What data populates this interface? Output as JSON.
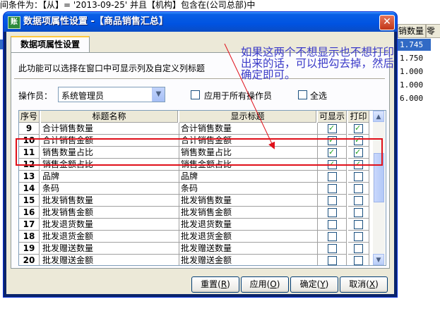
{
  "background": {
    "topline": "间条件为：【从】= '2013-09-25' 并且【机构】包含在(公司总部)中",
    "grid_headers": [
      "销数量",
      "零"
    ],
    "grid_values": [
      "1.745",
      "1.750",
      "1.000",
      "1.000",
      "6.000"
    ]
  },
  "window": {
    "icon": "icon-app",
    "title": "数据项属性设置 -【商品销售汇总】",
    "close_icon": "close-icon"
  },
  "tab": {
    "label": "数据项属性设置"
  },
  "description": "此功能可以选择在窗口中可显示列及自定义列标题",
  "operator": {
    "label": "操作员：",
    "value": "系统管理员",
    "apply_all_label": "应用于所有操作员",
    "apply_all_checked": false,
    "select_all_label": "全选",
    "select_all_checked": false
  },
  "grid": {
    "columns": [
      "序号",
      "标题名称",
      "显示标题",
      "可显示",
      "打印"
    ],
    "rows": [
      {
        "no": "9",
        "name": "合计销售数量",
        "display": "合计销售数量",
        "show": true,
        "print": true
      },
      {
        "no": "10",
        "name": "合计销售金额",
        "display": "合计销售金额",
        "show": true,
        "print": true
      },
      {
        "no": "11",
        "name": "销售数量占比",
        "display": "销售数量占比",
        "show": true,
        "print": true
      },
      {
        "no": "12",
        "name": "销售金额占比",
        "display": "销售金额占比",
        "show": true,
        "print": true
      },
      {
        "no": "13",
        "name": "品牌",
        "display": "品牌",
        "show": false,
        "print": false
      },
      {
        "no": "14",
        "name": "条码",
        "display": "条码",
        "show": false,
        "print": false
      },
      {
        "no": "15",
        "name": "批发销售数量",
        "display": "批发销售数量",
        "show": false,
        "print": false
      },
      {
        "no": "16",
        "name": "批发销售金额",
        "display": "批发销售金额",
        "show": false,
        "print": false
      },
      {
        "no": "17",
        "name": "批发退货数量",
        "display": "批发退货数量",
        "show": false,
        "print": false
      },
      {
        "no": "18",
        "name": "批发退货金额",
        "display": "批发退货金额",
        "show": false,
        "print": false
      },
      {
        "no": "19",
        "name": "批发赠送数量",
        "display": "批发赠送数量",
        "show": false,
        "print": false
      },
      {
        "no": "20",
        "name": "批发赠送金额",
        "display": "批发赠送金额",
        "show": false,
        "print": false
      }
    ]
  },
  "buttons": {
    "reset": {
      "text": "重置",
      "key": "R"
    },
    "apply": {
      "text": "应用",
      "key": "O"
    },
    "ok": {
      "text": "确定",
      "key": "Y"
    },
    "cancel": {
      "text": "取消",
      "key": "X"
    }
  },
  "annotation": {
    "text": "如果这两个不想显示也不想打印出来的话，可以把勾去掉，然后确定即可。",
    "color": "#3a3ac8",
    "highlight_color": "#e0101a"
  }
}
